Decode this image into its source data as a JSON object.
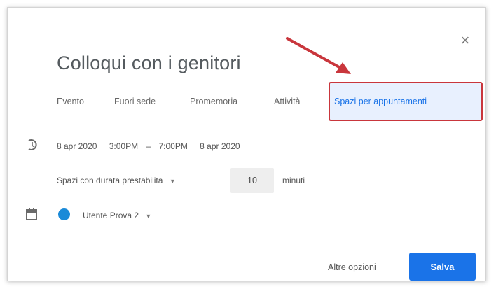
{
  "dialog": {
    "close_icon": "×",
    "title": "Colloqui con i genitori"
  },
  "tabs": [
    {
      "label": "Evento"
    },
    {
      "label": "Fuori sede"
    },
    {
      "label": "Promemoria"
    },
    {
      "label": "Attività"
    },
    {
      "label": "Spazi per appuntamenti"
    }
  ],
  "time": {
    "start_date": "8 apr 2020",
    "start_time": "3:00PM",
    "separator": "–",
    "end_time": "7:00PM",
    "end_date": "8 apr 2020"
  },
  "slots": {
    "type_label": "Spazi con durata prestabilita",
    "duration_value": "10",
    "duration_unit": "minuti"
  },
  "calendar": {
    "name": "Utente Prova 2",
    "color": "#1a8ad8"
  },
  "footer": {
    "more_label": "Altre opzioni",
    "save_label": "Salva"
  },
  "colors": {
    "accent": "#1a73e8",
    "highlight_border": "#c9363c",
    "arrow": "#c9363c"
  },
  "icons": {
    "close": "close-icon",
    "clock": "clock-icon",
    "calendar": "calendar-icon",
    "dropdown": "chevron-down-icon",
    "annotation": "arrow-annotation-icon"
  }
}
